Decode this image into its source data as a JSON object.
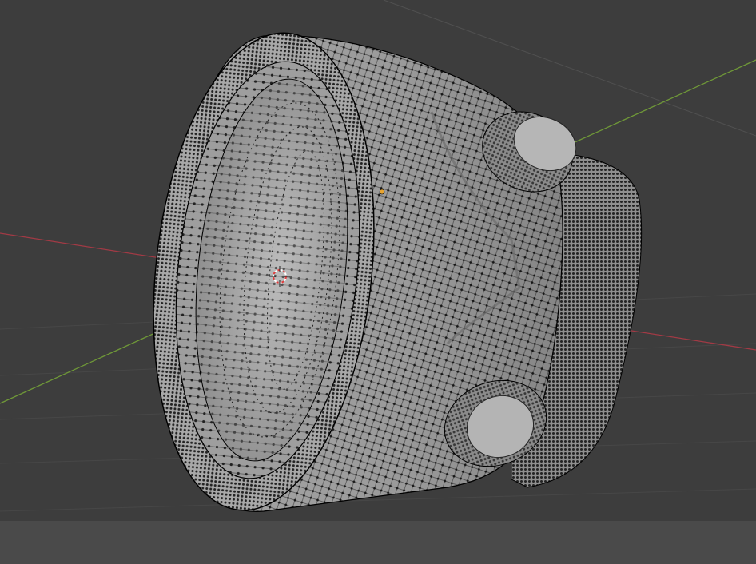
{
  "viewport": {
    "background_color": "#3d3d3d",
    "bottom_strip_color": "#4a4a4a",
    "grid_color": "#474747",
    "x_axis_color": "#a23a45",
    "y_axis_color": "#6f9838"
  },
  "mesh": {
    "object": "cylindrical-ring-with-two-knobs",
    "shade_color": "#9b9b9b",
    "wire_color": "#000000",
    "vertex_color": "#000000"
  },
  "origin_marker": {
    "color": "#e8a531"
  },
  "cursor_3d": {
    "icon": "3d-cursor-icon",
    "colors": [
      "#e03c3c",
      "#ffffff"
    ]
  }
}
